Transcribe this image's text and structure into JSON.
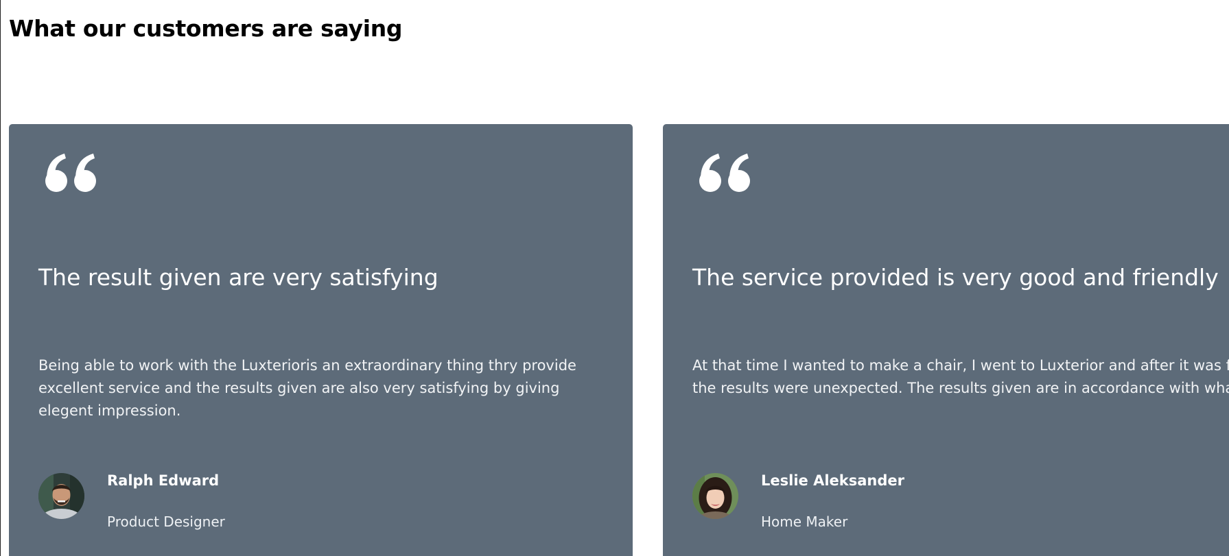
{
  "section": {
    "title": "What our customers are saying"
  },
  "testimonials": [
    {
      "icon": "quote-icon",
      "title": "The result given are very satisfying",
      "text": "Being able to work with the Luxterioris an extraordinary thing thry provide excellent service and the results given are also very satisfying by giving elegent impression.",
      "author_name": "Ralph Edward",
      "author_role": "Product Designer",
      "avatar": "avatar-ralph-edward"
    },
    {
      "icon": "quote-icon",
      "title": "The service provided is very good and friendly",
      "text": "At that time I wanted to make a chair, I went to Luxterior and after it was finished the results were unexpected. The results given are in accordance with what I want.",
      "author_name": "Leslie Aleksander",
      "author_role": "Home Maker",
      "avatar": "avatar-leslie-aleksander"
    }
  ],
  "colors": {
    "card_background": "#5d6b79",
    "card_text": "#ffffff",
    "page_background": "#ffffff",
    "heading": "#000000"
  }
}
